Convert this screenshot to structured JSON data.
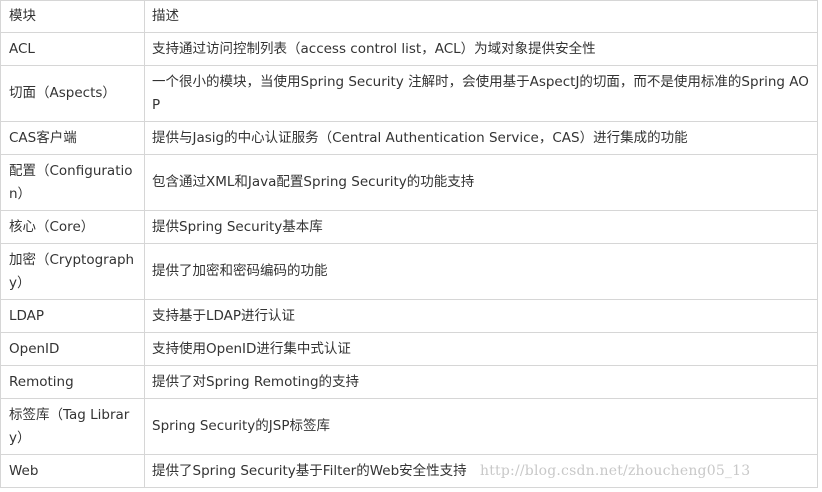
{
  "table": {
    "header": {
      "module": "模块",
      "description": "描述"
    },
    "rows": [
      {
        "module": "ACL",
        "description": "支持通过访问控制列表（access control list，ACL）为域对象提供安全性"
      },
      {
        "module": "切面（Aspects）",
        "description": "一个很小的模块，当使用Spring Security 注解时，会使用基于AspectJ的切面，而不是使用标准的Spring AOP"
      },
      {
        "module": "CAS客户端",
        "description": "提供与Jasig的中心认证服务（Central Authentication Service，CAS）进行集成的功能"
      },
      {
        "module": "配置（Configuration）",
        "description": "包含通过XML和Java配置Spring Security的功能支持"
      },
      {
        "module": "核心（Core）",
        "description": "提供Spring Security基本库"
      },
      {
        "module": "加密（Cryptography）",
        "description": "提供了加密和密码编码的功能"
      },
      {
        "module": "LDAP",
        "description": "支持基于LDAP进行认证"
      },
      {
        "module": "OpenID",
        "description": "支持使用OpenID进行集中式认证"
      },
      {
        "module": "Remoting",
        "description": "提供了对Spring Remoting的支持"
      },
      {
        "module": "标签库（Tag Library）",
        "description": "Spring Security的JSP标签库"
      },
      {
        "module": "Web",
        "description": "提供了Spring Security基于Filter的Web安全性支持"
      }
    ]
  },
  "watermark": "http://blog.csdn.net/zhoucheng05_13"
}
